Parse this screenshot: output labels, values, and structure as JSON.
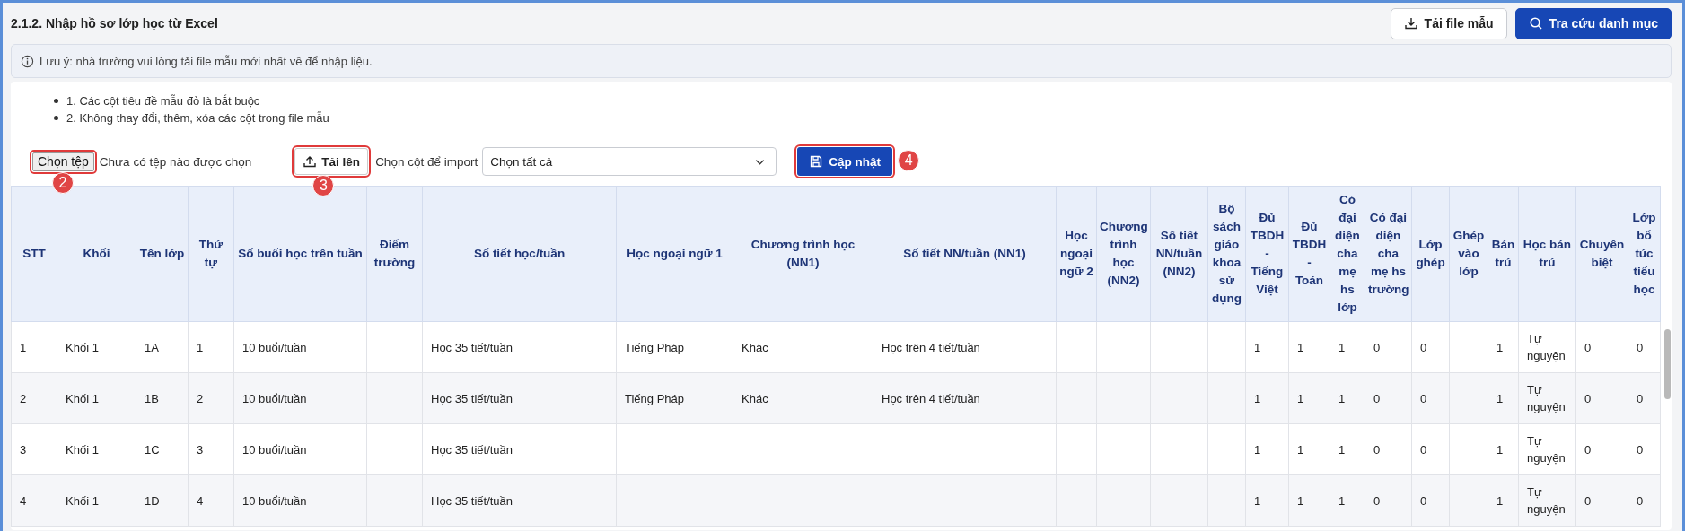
{
  "header": {
    "title": "2.1.2. Nhập hồ sơ lớp học từ Excel",
    "buttons": [
      {
        "label": "Tải file mẫu",
        "kind": "outline"
      },
      {
        "label": "Tra cứu danh mục",
        "kind": "primary"
      }
    ]
  },
  "notice": {
    "text": "Lưu ý: nhà trường vui lòng tải file mẫu mới nhất về để nhập liệu."
  },
  "instructions": [
    "1. Các cột tiêu đề mẫu đỏ là bắt buộc",
    "2. Không thay đổi, thêm, xóa các cột trong file mẫu"
  ],
  "upload": {
    "file_button": {
      "label": "Chọn tệp",
      "marker": "2"
    },
    "file_status": "Chưa có tệp nào được chọn",
    "upload_button": {
      "label": "Tải lên",
      "marker": "3"
    },
    "column_label": "Chọn cột để import",
    "column_select": {
      "value": "Chọn tất cả"
    },
    "update_button": {
      "label": "Cập nhật",
      "marker": "4"
    }
  },
  "table": {
    "columns": [
      "STT",
      "Khối",
      "Tên lớp",
      "Thứ tự",
      "Số buổi học trên tuần",
      "Điểm trường",
      "Số tiết học/tuần",
      "Học ngoại ngữ 1",
      "Chương trình học (NN1)",
      "Số tiết NN/tuần (NN1)",
      "Học ngoại ngữ 2",
      "Chương trình học (NN2)",
      "Số tiết NN/tuần (NN2)",
      "Bộ sách giáo khoa sử dụng",
      "Đủ TBDH - Tiếng Việt",
      "Đủ TBDH - Toán",
      "Có đại diện cha mẹ hs lớp",
      "Có đại diện cha mẹ hs trường",
      "Lớp ghép",
      "Ghép vào lớp",
      "Bán trú",
      "Học bán trú",
      "Chuyên biệt",
      "Lớp bổ túc tiểu học"
    ],
    "rows": [
      [
        "1",
        "Khối 1",
        "1A",
        "1",
        "10 buổi/tuần",
        null,
        "Học 35 tiết/tuần",
        "Tiếng Pháp",
        "Khác",
        "Học trên 4 tiết/tuần",
        null,
        null,
        null,
        null,
        "1",
        "1",
        "1",
        "0",
        "0",
        null,
        "1",
        "Tự nguyện",
        "0",
        "0"
      ],
      [
        "2",
        "Khối 1",
        "1B",
        "2",
        "10 buổi/tuần",
        null,
        "Học 35 tiết/tuần",
        "Tiếng Pháp",
        "Khác",
        "Học trên 4 tiết/tuần",
        null,
        null,
        null,
        null,
        "1",
        "1",
        "1",
        "0",
        "0",
        null,
        "1",
        "Tự nguyện",
        "0",
        "0"
      ],
      [
        "3",
        "Khối 1",
        "1C",
        "3",
        "10 buổi/tuần",
        null,
        "Học 35 tiết/tuần",
        null,
        null,
        null,
        null,
        null,
        null,
        null,
        "1",
        "1",
        "1",
        "0",
        "0",
        null,
        "1",
        "Tự nguyện",
        "0",
        "0"
      ],
      [
        "4",
        "Khối 1",
        "1D",
        "4",
        "10 buổi/tuần",
        null,
        "Học 35 tiết/tuần",
        null,
        null,
        null,
        null,
        null,
        null,
        null,
        "1",
        "1",
        "1",
        "0",
        "0",
        null,
        "1",
        "Tự nguyện",
        "0",
        "0"
      ]
    ]
  }
}
